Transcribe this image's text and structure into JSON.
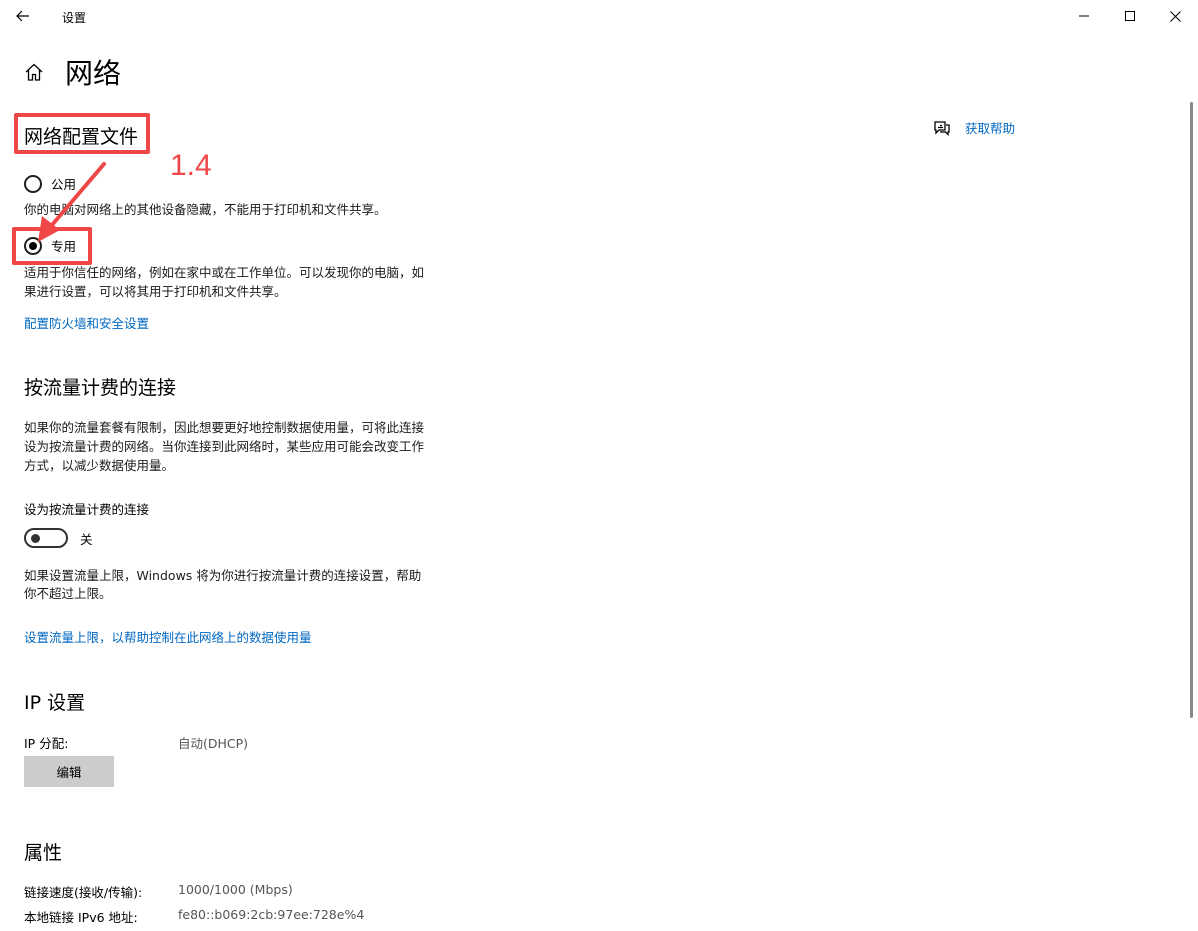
{
  "window": {
    "title": "设置",
    "back_icon": "arrow-left-icon",
    "minimize_icon": "minimize-icon",
    "maximize_icon": "maximize-icon",
    "close_icon": "close-icon"
  },
  "header": {
    "home_icon": "home-icon",
    "title": "网络"
  },
  "help": {
    "icon": "help-chat-icon",
    "label": "获取帮助"
  },
  "network_profile": {
    "title": "网络配置文件",
    "options": [
      {
        "label": "公用",
        "selected": false,
        "description": "你的电脑对网络上的其他设备隐藏，不能用于打印机和文件共享。"
      },
      {
        "label": "专用",
        "selected": true,
        "description_line1": "适用于你信任的网络，例如在家中或在工作单位。可以发现你的电脑，如",
        "description_line2": "果进行设置，可以将其用于打印机和文件共享。"
      }
    ],
    "firewall_link": "配置防火墙和安全设置"
  },
  "metered": {
    "title": "按流量计费的连接",
    "desc_line1": "如果你的流量套餐有限制，因此想要更好地控制数据使用量，可将此连接",
    "desc_line2": "设为按流量计费的网络。当你连接到此网络时，某些应用可能会改变工作",
    "desc_line3": "方式，以减少数据使用量。",
    "toggle_label": "设为按流量计费的连接",
    "toggle_state": "关",
    "toggle_on": false,
    "limit_line1": "如果设置流量上限，Windows 将为你进行按流量计费的连接设置，帮助",
    "limit_line2": "你不超过上限。",
    "limit_link": "设置流量上限，以帮助控制在此网络上的数据使用量"
  },
  "ip": {
    "title": "IP 设置",
    "assign_label": "IP 分配:",
    "assign_value": "自动(DHCP)",
    "edit_button": "编辑"
  },
  "properties": {
    "title": "属性",
    "rows": [
      {
        "label": "链接速度(接收/传输):",
        "value": "1000/1000 (Mbps)"
      },
      {
        "label": "本地链接 IPv6 地址:",
        "value": "fe80::b069:2cb:97ee:728e%4"
      }
    ]
  },
  "annotation": {
    "step_label": "1.4",
    "color": "#ef4747"
  }
}
